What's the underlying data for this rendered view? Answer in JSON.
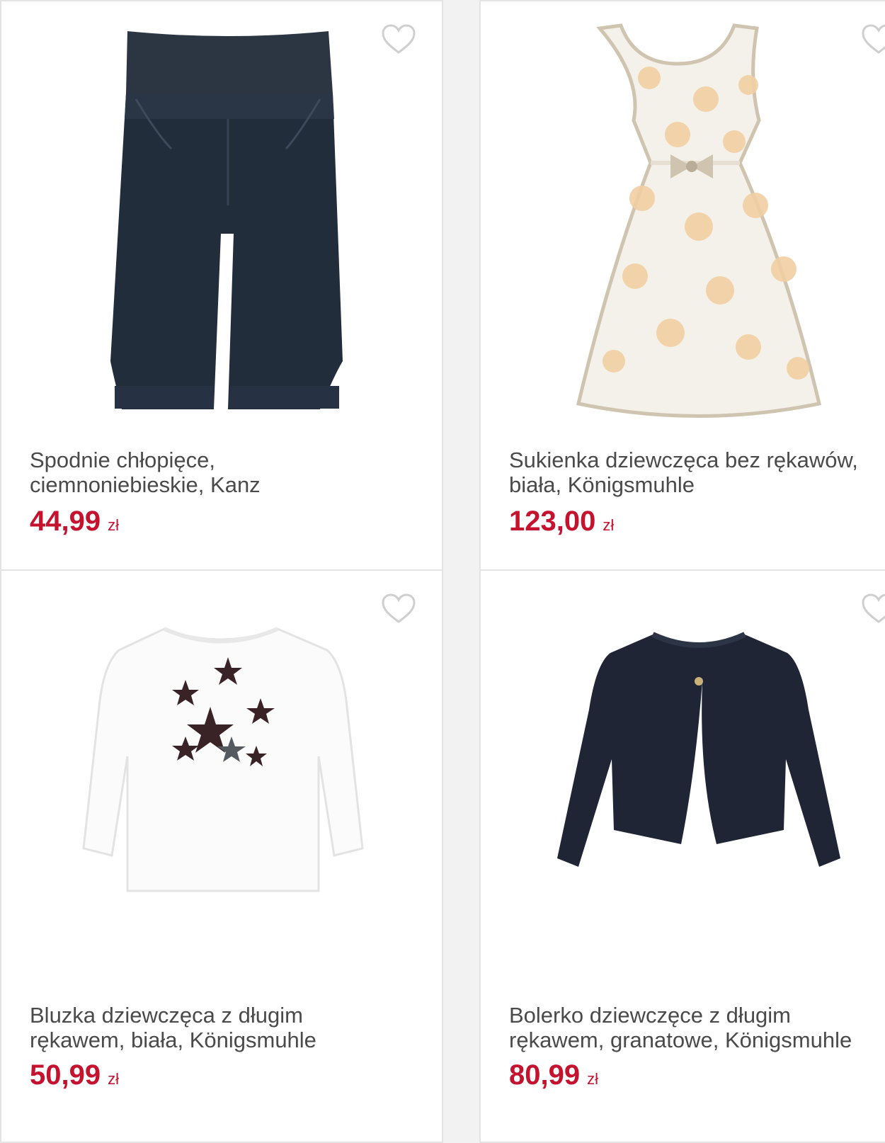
{
  "colors": {
    "accent": "#c4122f",
    "text": "#4a4a4a",
    "border": "#e4e4e4"
  },
  "products": [
    {
      "title_line1": "Spodnie chłopięce,",
      "title_line2": "ciemnoniebieskie, Kanz",
      "price": "44,99",
      "currency": "zł",
      "image": "navy-pants-image",
      "icon": "heart-outline-icon"
    },
    {
      "title_line1": "Sukienka dziewczęca bez rękawów,",
      "title_line2": "biała, Königsmuhle",
      "price": "123,00",
      "currency": "zł",
      "image": "floral-dress-image",
      "icon": "heart-outline-icon"
    },
    {
      "title_line1": "Bluzka dziewczęca z długim",
      "title_line2": "rękawem, biała, Königsmuhle",
      "price": "50,99",
      "currency": "zł",
      "image": "white-star-blouse-image",
      "icon": "heart-outline-icon"
    },
    {
      "title_line1": "Bolerko dziewczęce z długim",
      "title_line2": "rękawem, granatowe, Königsmuhle",
      "price": "80,99",
      "currency": "zł",
      "image": "navy-bolero-image",
      "icon": "heart-outline-icon"
    }
  ]
}
